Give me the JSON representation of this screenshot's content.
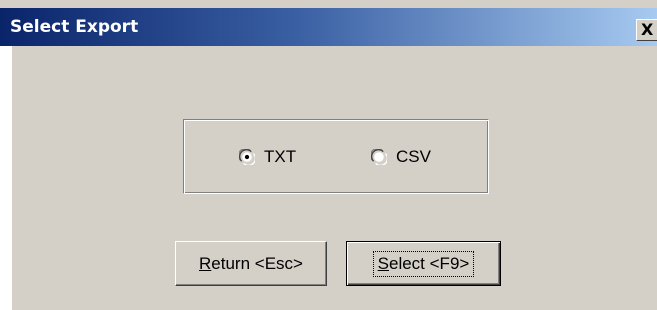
{
  "window": {
    "title": "Select Export",
    "close_label": "X"
  },
  "export_format": {
    "options": [
      {
        "label": "TXT",
        "selected": true
      },
      {
        "label": "CSV",
        "selected": false
      }
    ]
  },
  "buttons": {
    "return": {
      "mnemonic": "R",
      "rest": "eturn <Esc>"
    },
    "select": {
      "mnemonic": "S",
      "rest": "elect <F9>"
    }
  }
}
